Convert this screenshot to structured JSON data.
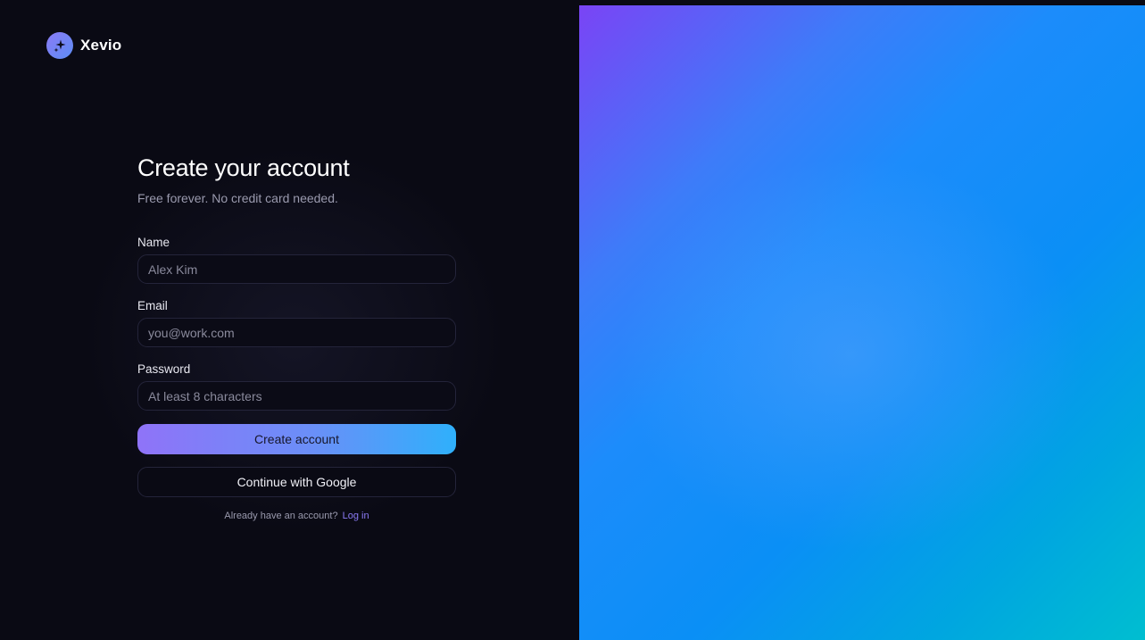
{
  "brand": {
    "name": "Xevio",
    "logo_icon": "sparkles-icon"
  },
  "form": {
    "title": "Create your account",
    "subtitle": "Free forever. No credit card needed.",
    "fields": [
      {
        "label": "Name",
        "placeholder": "Alex Kim",
        "value": ""
      },
      {
        "label": "Email",
        "placeholder": "you@work.com",
        "value": ""
      },
      {
        "label": "Password",
        "placeholder": "At least 8 characters",
        "value": ""
      }
    ],
    "primary_button_label": "Create account",
    "google_button_label": "Continue with Google",
    "footer_text": "Already have an account?",
    "login_link_label": "Log in"
  },
  "colors": {
    "background": "#0a0a14",
    "accent": "#8b7bf5",
    "primary_gradient_start": "#8f73f8",
    "primary_gradient_end": "#2fb0fb",
    "panel_gradient_start": "#7a44f5",
    "panel_gradient_end": "#00bed0"
  }
}
